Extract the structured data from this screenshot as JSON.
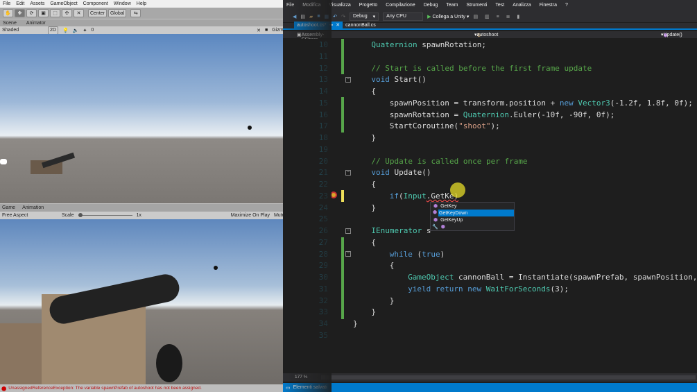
{
  "unity": {
    "menu": [
      "File",
      "Edit",
      "Assets",
      "GameObject",
      "Component",
      "Window",
      "Help"
    ],
    "toolbar": {
      "center": "Center",
      "global": "Global"
    },
    "scene_tabs": [
      "Scene",
      "Animator"
    ],
    "scene_bar": {
      "shading": "Shaded",
      "mode2d": "2D",
      "gizmos": "Gizmos",
      "layers": "0"
    },
    "game_tabs": [
      "Game",
      "Animation"
    ],
    "game_bar": {
      "aspect": "Free Aspect",
      "scale_label": "Scale",
      "scale_value": "1x",
      "maximize": "Maximize On Play",
      "mute": "Mute Audio"
    },
    "status": "UnassignedReferenceException: The variable spawnPrefab of autoshoot has not been assigned."
  },
  "vs": {
    "menu": [
      "File",
      "Modifica",
      "Visualizza",
      "Progetto",
      "Compilazione",
      "Debug",
      "Team",
      "Strumenti",
      "Test",
      "Analizza",
      "Finestra",
      "?"
    ],
    "toolbar": {
      "config": "Debug",
      "platform": "Any CPU",
      "attach": "Collega a Unity"
    },
    "tabs": [
      {
        "label": "autoshoot.cs*",
        "active": true
      },
      {
        "label": "cannonBall.cs",
        "active": false
      }
    ],
    "nav": {
      "project": "Assembly-CSharp",
      "class": "autoshoot",
      "member": "Update()"
    },
    "zoom": "177 %",
    "status": "Elementi salvati",
    "autocomplete": {
      "items": [
        "GetKey",
        "GetKeyDown",
        "GetKeyUp"
      ],
      "selected": 1
    },
    "colors": {
      "kw": "#569cd6",
      "type": "#4ec9b0",
      "str": "#d69d85",
      "com": "#57a64a",
      "num": "#b5cea8",
      "txt": "#dcdcdc"
    },
    "code": [
      {
        "n": "10",
        "i": 1,
        "t": [
          [
            "type",
            "Quaternion"
          ],
          [
            "txt",
            " spawnRotation;"
          ]
        ]
      },
      {
        "n": "11",
        "i": 1,
        "t": []
      },
      {
        "n": "12",
        "i": 1,
        "t": [
          [
            "com",
            "// Start is called before the first frame update"
          ]
        ]
      },
      {
        "n": "13",
        "i": 1,
        "t": [
          [
            "kw",
            "void"
          ],
          [
            "txt",
            " Start()"
          ]
        ]
      },
      {
        "n": "14",
        "i": 1,
        "t": [
          [
            "txt",
            "{"
          ]
        ]
      },
      {
        "n": "15",
        "i": 2,
        "t": [
          [
            "txt",
            "spawnPosition = transform.position + "
          ],
          [
            "kw",
            "new"
          ],
          [
            "txt",
            " "
          ],
          [
            "type",
            "Vector3"
          ],
          [
            "txt",
            "(-1.2f, 1.8f, 0f);"
          ]
        ]
      },
      {
        "n": "16",
        "i": 2,
        "t": [
          [
            "txt",
            "spawnRotation = "
          ],
          [
            "type",
            "Quaternion"
          ],
          [
            "txt",
            ".Euler(-10f, -90f, 0f);"
          ]
        ]
      },
      {
        "n": "17",
        "i": 2,
        "t": [
          [
            "txt",
            "StartCoroutine("
          ],
          [
            "str",
            "\"shoot\""
          ],
          [
            "txt",
            ");"
          ]
        ]
      },
      {
        "n": "18",
        "i": 1,
        "t": [
          [
            "txt",
            "}"
          ]
        ]
      },
      {
        "n": "19",
        "i": 1,
        "t": []
      },
      {
        "n": "20",
        "i": 1,
        "t": [
          [
            "com",
            "// Update is called once per frame"
          ]
        ]
      },
      {
        "n": "21",
        "i": 1,
        "t": [
          [
            "kw",
            "void"
          ],
          [
            "txt",
            " Update()"
          ]
        ]
      },
      {
        "n": "22",
        "i": 1,
        "t": [
          [
            "txt",
            "{"
          ]
        ]
      },
      {
        "n": "23",
        "i": 2,
        "t": [
          [
            "kw",
            "if"
          ],
          [
            "txt",
            "("
          ],
          [
            "type",
            "Input"
          ],
          [
            "txt",
            ".GetKe)"
          ]
        ]
      },
      {
        "n": "24",
        "i": 1,
        "t": [
          [
            "txt",
            "}"
          ]
        ]
      },
      {
        "n": "25",
        "i": 1,
        "t": []
      },
      {
        "n": "26",
        "i": 1,
        "t": [
          [
            "type",
            "IEnumerator"
          ],
          [
            "txt",
            " s"
          ]
        ]
      },
      {
        "n": "27",
        "i": 1,
        "t": [
          [
            "txt",
            "{"
          ]
        ]
      },
      {
        "n": "28",
        "i": 2,
        "t": [
          [
            "kw",
            "while"
          ],
          [
            "txt",
            " ("
          ],
          [
            "kw",
            "true"
          ],
          [
            "txt",
            ")"
          ]
        ]
      },
      {
        "n": "29",
        "i": 2,
        "t": [
          [
            "txt",
            "{"
          ]
        ]
      },
      {
        "n": "30",
        "i": 3,
        "t": [
          [
            "type",
            "GameObject"
          ],
          [
            "txt",
            " cannonBall = Instantiate(spawnPrefab, spawnPosition,"
          ]
        ]
      },
      {
        "n": "31",
        "i": 3,
        "t": [
          [
            "kw",
            "yield return new"
          ],
          [
            "txt",
            " "
          ],
          [
            "type",
            "WaitForSeconds"
          ],
          [
            "txt",
            "(3);"
          ]
        ]
      },
      {
        "n": "32",
        "i": 2,
        "t": [
          [
            "txt",
            "}"
          ]
        ]
      },
      {
        "n": "33",
        "i": 1,
        "t": [
          [
            "txt",
            "}"
          ]
        ]
      },
      {
        "n": "34",
        "i": 0,
        "t": [
          [
            "txt",
            "}"
          ]
        ]
      },
      {
        "n": "35",
        "i": 0,
        "t": []
      }
    ]
  }
}
